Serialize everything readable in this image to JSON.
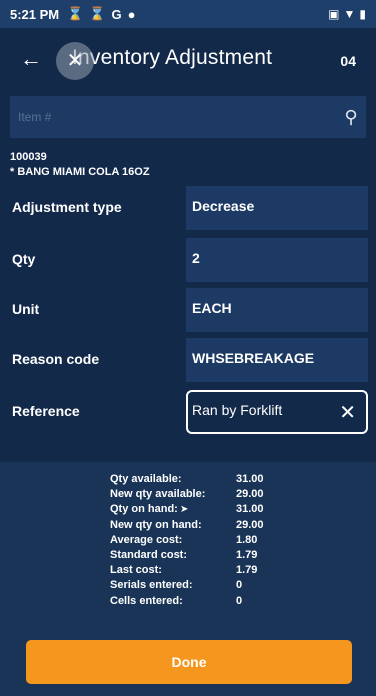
{
  "status_bar": {
    "time": "5:21 PM",
    "icons": [
      "hourglass-icon",
      "hourglass-icon",
      "G",
      "circle-icon"
    ],
    "right_icons": [
      "nfc-icon",
      "wifi-icon",
      "battery-icon"
    ]
  },
  "header": {
    "title": "Inventory Adjustment",
    "store": "04"
  },
  "search": {
    "placeholder": "Item #",
    "value": ""
  },
  "item": {
    "code": "100039",
    "description": "* BANG MIAMI COLA 16OZ"
  },
  "form": {
    "adjustment_type": {
      "label": "Adjustment type",
      "value": "Decrease"
    },
    "qty": {
      "label": "Qty",
      "value": "2"
    },
    "unit": {
      "label": "Unit",
      "value": "EACH"
    },
    "reason_code": {
      "label": "Reason code",
      "value": "WHSEBREAKAGE"
    },
    "reference": {
      "label": "Reference",
      "value": "Ran by Forklift"
    }
  },
  "summary": [
    {
      "label": "Qty available:",
      "value": "31.00"
    },
    {
      "label": "New qty available:",
      "value": "29.00"
    },
    {
      "label": "Qty on hand:",
      "value": "31.00"
    },
    {
      "label": "New qty on hand:",
      "value": "29.00"
    },
    {
      "label": "Average cost:",
      "value": "1.80"
    },
    {
      "label": "Standard cost:",
      "value": "1.79"
    },
    {
      "label": "Last cost:",
      "value": "1.79"
    },
    {
      "label": "Serials entered:",
      "value": "0"
    },
    {
      "label": "Cells entered:",
      "value": "0"
    }
  ],
  "done_label": "Done",
  "colors": {
    "background": "#13294a",
    "field": "#1c3a63",
    "accent": "#f5961e"
  }
}
